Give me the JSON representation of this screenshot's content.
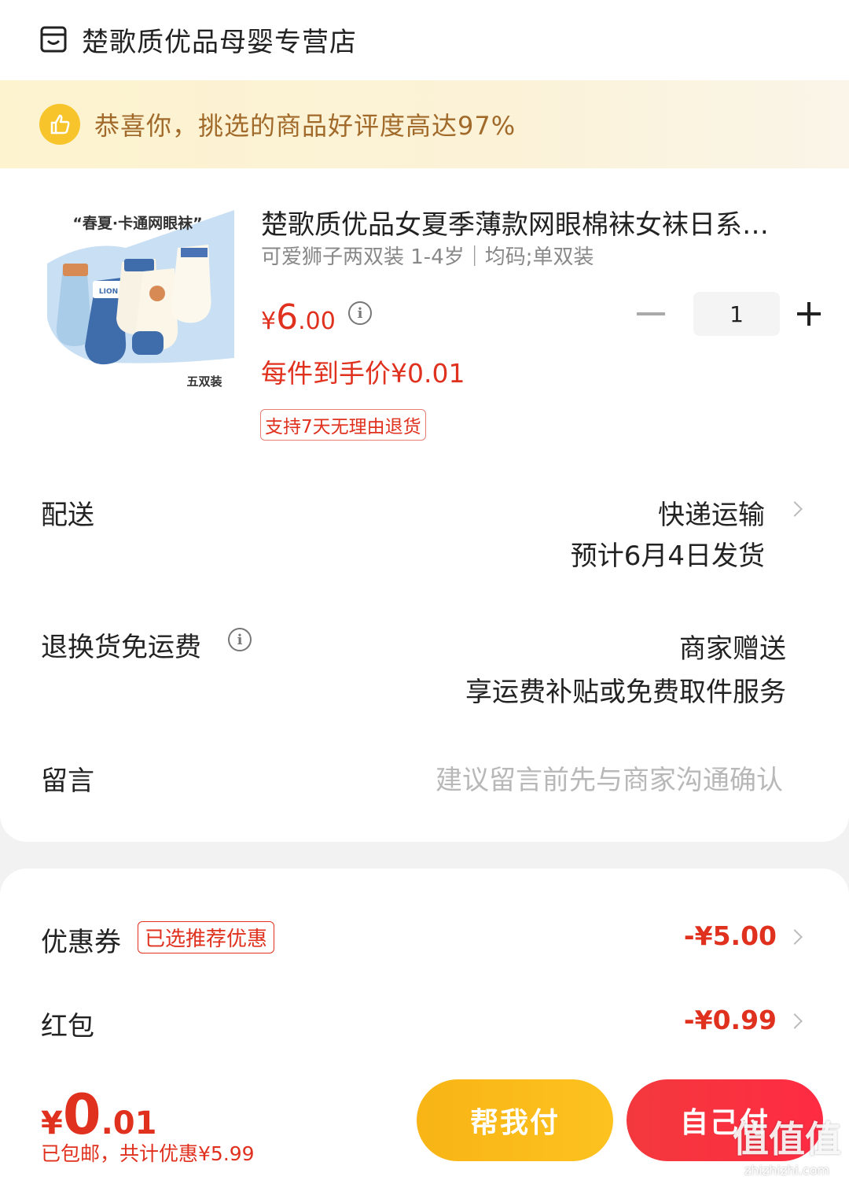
{
  "store": {
    "name": "楚歌质优品母婴专营店",
    "icon": "store-icon"
  },
  "banner": {
    "text": "恭喜你，挑选的商品好评度高达97%",
    "icon": "thumbs-up-icon"
  },
  "product": {
    "title": "楚歌质优品女夏季薄款网眼棉袜女袜日系…",
    "sku": "可爱狮子两双装 1-4岁｜均码;单双装",
    "price_currency": "¥",
    "price_int": "6",
    "price_dec": ".00",
    "unit_price": "每件到手价¥0.01",
    "return_tag": "支持7天无理由退货",
    "quantity": "1",
    "image_caption_top": "“春夏·卡通网眼袜”",
    "image_caption_bottom": "五双装",
    "image_label": "LION"
  },
  "delivery": {
    "label": "配送",
    "method": "快递运输",
    "eta": "预计6月4日发货"
  },
  "return_shipping": {
    "label": "退换货免运费",
    "value": "商家赠送",
    "detail": "享运费补贴或免费取件服务"
  },
  "message": {
    "label": "留言",
    "placeholder": "建议留言前先与商家沟通确认"
  },
  "coupon": {
    "label": "优惠券",
    "tag": "已选推荐优惠",
    "amount": "-¥5.00"
  },
  "red_packet": {
    "label": "红包",
    "amount": "-¥0.99"
  },
  "footer": {
    "total_currency": "¥",
    "total_int": "0",
    "total_dec": ".01",
    "shipping": "已包邮，",
    "discount": "共计优惠¥5.99",
    "help_pay": "帮我付",
    "self_pay": "自己付"
  },
  "watermark": {
    "text": "值值值",
    "sub": "zhizhizhi.com"
  },
  "colors": {
    "accent_red": "#e0301e",
    "yellow_button": "#fdc21f",
    "red_button": "#ff2b43",
    "banner_text": "#a16a2a"
  }
}
